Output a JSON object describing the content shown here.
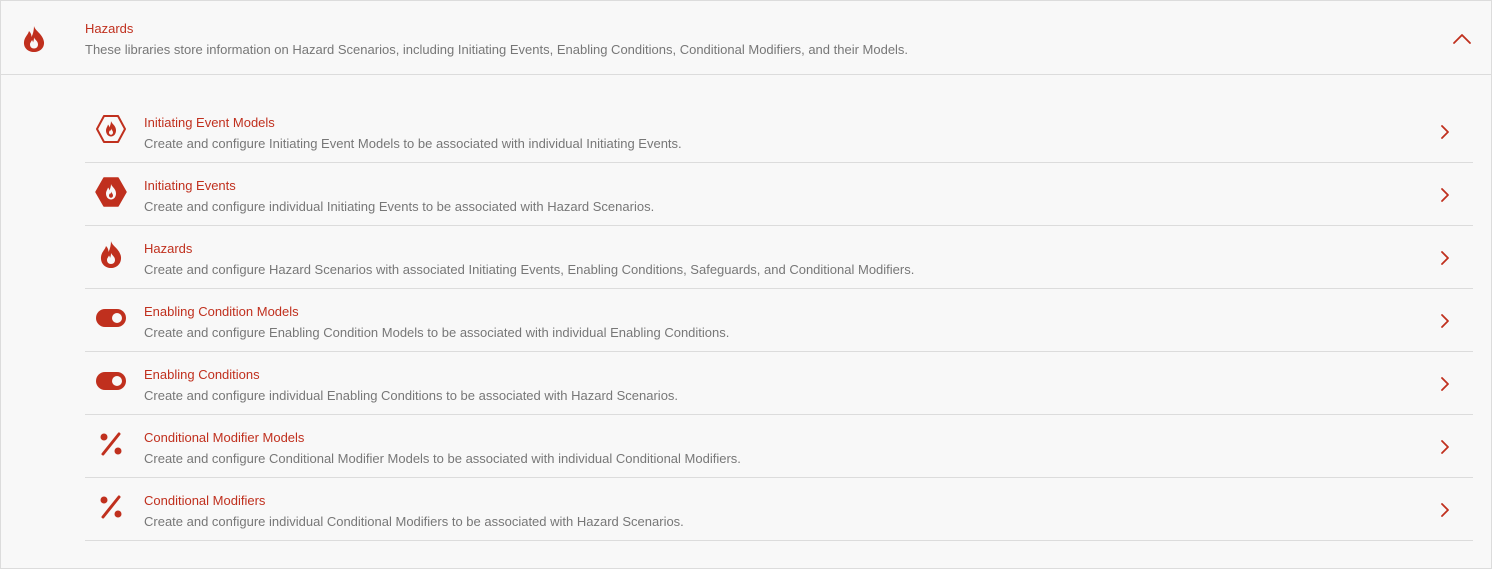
{
  "accent_color": "#c0301e",
  "text_muted_color": "#777777",
  "header": {
    "icon": "flame-icon",
    "title": "Hazards",
    "description": "These libraries store information on Hazard Scenarios, including Initiating Events, Enabling Conditions, Conditional Modifiers, and their Models.",
    "toggle_icon": "chevron-up-icon"
  },
  "items": [
    {
      "icon": "hexagon-flame-outline-icon",
      "title": "Initiating Event Models",
      "description": "Create and configure Initiating Event Models to be associated with individual Initiating Events."
    },
    {
      "icon": "hexagon-flame-filled-icon",
      "title": "Initiating Events",
      "description": "Create and configure individual Initiating Events to be associated with Hazard Scenarios."
    },
    {
      "icon": "flame-icon",
      "title": "Hazards",
      "description": "Create and configure Hazard Scenarios with associated Initiating Events, Enabling Conditions, Safeguards, and Conditional Modifiers."
    },
    {
      "icon": "toggle-icon",
      "title": "Enabling Condition Models",
      "description": "Create and configure Enabling Condition Models to be associated with individual Enabling Conditions."
    },
    {
      "icon": "toggle-icon",
      "title": "Enabling Conditions",
      "description": "Create and configure individual Enabling Conditions to be associated with Hazard Scenarios."
    },
    {
      "icon": "percent-icon",
      "title": "Conditional Modifier Models",
      "description": "Create and configure Conditional Modifier Models to be associated with individual Conditional Modifiers."
    },
    {
      "icon": "percent-icon",
      "title": "Conditional Modifiers",
      "description": "Create and configure individual Conditional Modifiers to be associated with Hazard Scenarios."
    }
  ]
}
